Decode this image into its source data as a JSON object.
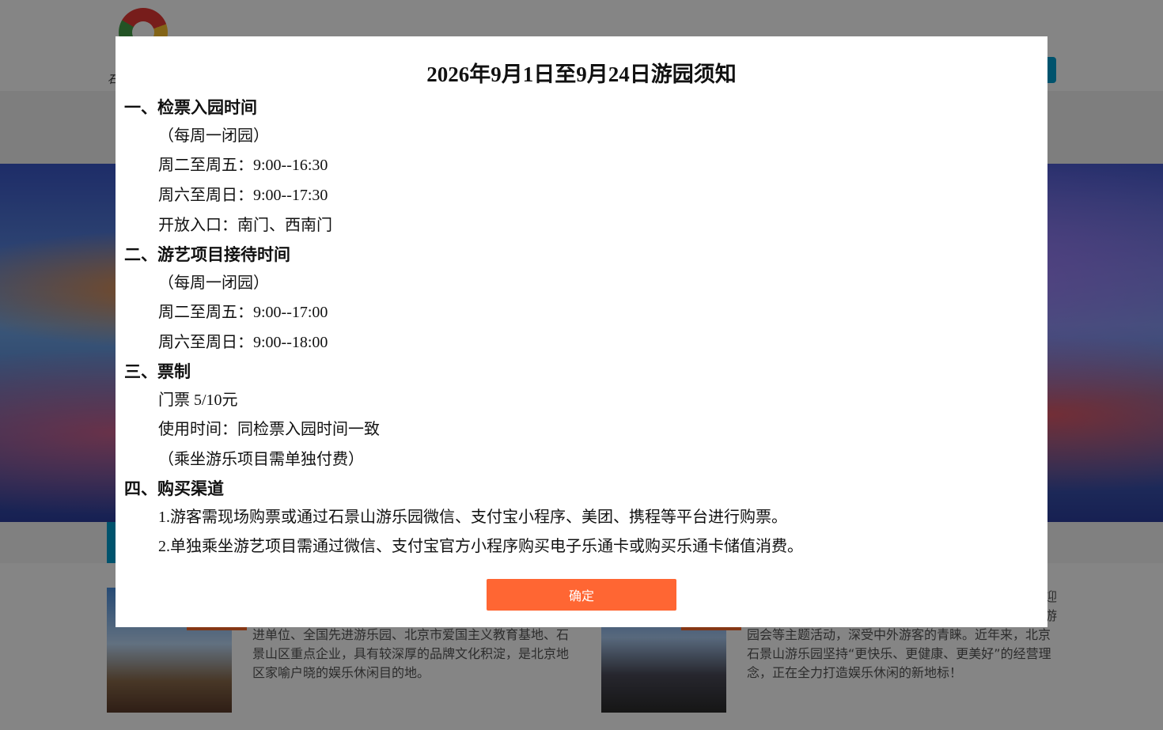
{
  "background": {
    "header": {
      "logo_text": "石"
    },
    "intro_left": {
      "text": "进单位、全国先进游乐园、北京市爱国主义教育基地、石景山区重点企业，具有较深厚的品牌文化积淀，是北京地区家喻户晓的娱乐休闲目的地。"
    },
    "intro_right": {
      "text_top": "迎",
      "text_top2": "游",
      "text": "园会等主题活动，深受中外游客的青睐。近年来，北京石景山游乐园坚持“更快乐、更健康、更美好”的经营理念，正在全力打造娱乐休闲的新地标！"
    }
  },
  "modal": {
    "title": "2026年9月1日至9月24日游园须知",
    "sections": [
      {
        "heading": "一、检票入园时间",
        "lines": [
          "（每周一闭园）",
          "周二至周五：9:00--16:30",
          "周六至周日：9:00--17:30",
          "开放入口：南门、西南门"
        ]
      },
      {
        "heading": "二、游艺项目接待时间",
        "lines": [
          "（每周一闭园）",
          "周二至周五：9:00--17:00",
          "周六至周日：9:00--18:00"
        ]
      },
      {
        "heading": "三、票制",
        "lines": [
          "门票 5/10元",
          "使用时间：同检票入园时间一致",
          "（乘坐游乐项目需单独付费）"
        ]
      },
      {
        "heading": "四、购买渠道",
        "lines": [
          "1.游客需现场购票或通过石景山游乐园微信、支付宝小程序、美团、携程等平台进行购票。",
          "2.单独乘坐游艺项目需通过微信、支付宝官方小程序购买电子乐通卡或购买乐通卡储值消费。"
        ]
      }
    ],
    "confirm_label": "确定"
  },
  "colors": {
    "accent_button": "#ff6633",
    "brand_blue": "#00a0d2",
    "overlay": "rgba(0,0,0,0.48)"
  }
}
